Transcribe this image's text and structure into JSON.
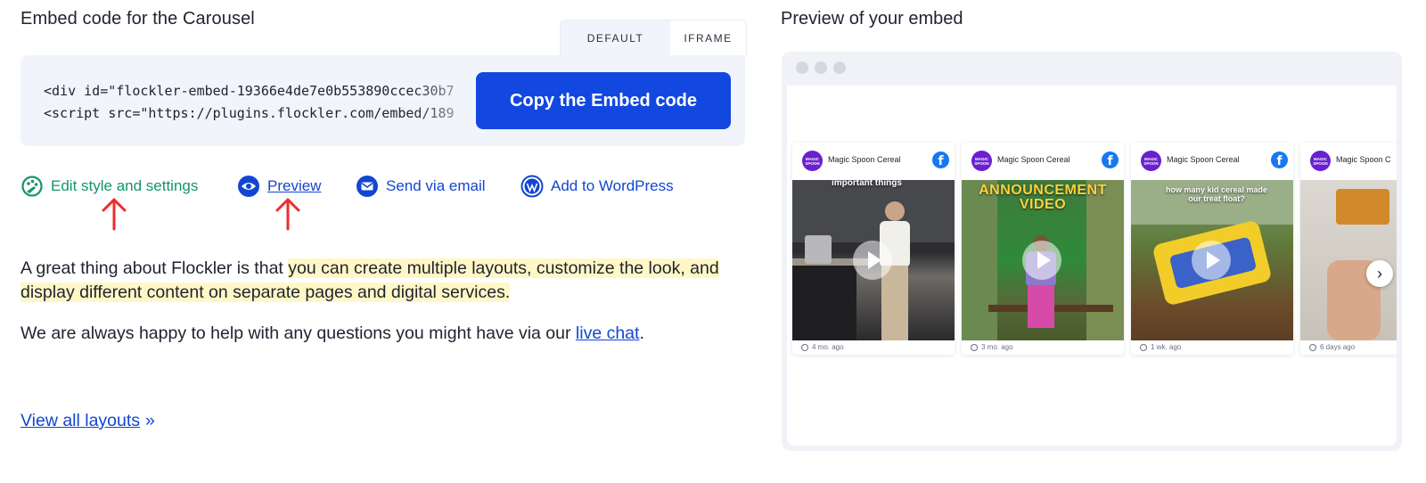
{
  "embed": {
    "title": "Embed code for the Carousel",
    "tabs": [
      {
        "label": "DEFAULT",
        "active": true
      },
      {
        "label": "IFRAME",
        "active": false
      }
    ],
    "code_lines": [
      "<div id=\"flockler-embed-19366e4de7e0b553890ccec30b7",
      "<script src=\"https://plugins.flockler.com/embed/189"
    ],
    "copy_label": "Copy the Embed code"
  },
  "actions": [
    {
      "label": "Edit style and settings",
      "icon": "paint-palette-icon"
    },
    {
      "label": "Preview",
      "icon": "eye-icon"
    },
    {
      "label": "Send via email",
      "icon": "envelope-icon"
    },
    {
      "label": "Add to WordPress",
      "icon": "wordpress-icon"
    }
  ],
  "body": {
    "para1_plain": "A great thing about Flockler is that ",
    "para1_highlight": "you can create multiple layouts, customize the look, and display different content on separate pages and digital services.",
    "para2_before": "We are always happy to help with any questions you might have via our ",
    "para2_link": "live chat",
    "para2_after": ".",
    "view_all": "View all layouts",
    "view_all_suffix": "»"
  },
  "preview": {
    "title": "Preview of your embed",
    "cards": [
      {
        "author": "Magic Spoon Cereal",
        "age": "4 mo. ago",
        "caption": "important things",
        "avatar_text": "MAGIC SPOON"
      },
      {
        "author": "Magic Spoon Cereal",
        "age": "3 mo. ago",
        "caption": "ANNOUNCEMENT VIDEO",
        "avatar_text": "MAGIC SPOON"
      },
      {
        "author": "Magic Spoon Cereal",
        "age": "1 wk. ago",
        "caption": "how many kid cereal made our treat float?",
        "avatar_text": "MAGIC SPOON"
      },
      {
        "author": "Magic Spoon C",
        "age": "6 days ago",
        "caption": "",
        "avatar_text": "MAGIC SPOON"
      }
    ],
    "colors": {
      "accent": "#1248e0",
      "edit": "#14956b",
      "highlight": "#fff8c6",
      "facebook": "#1778f2"
    }
  }
}
